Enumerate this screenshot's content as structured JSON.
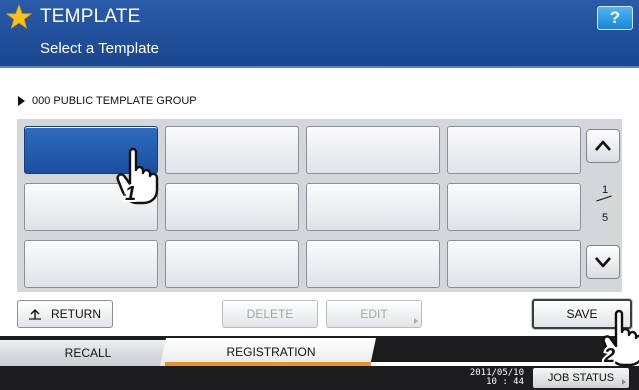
{
  "header": {
    "title": "TEMPLATE",
    "subtitle": "Select a Template",
    "help_label": "?"
  },
  "group": {
    "label": "000 PUBLIC TEMPLATE GROUP"
  },
  "grid": {
    "rows": 3,
    "columns": 4,
    "selected_index": 0
  },
  "pagination": {
    "current": "1",
    "total": "5"
  },
  "buttons": {
    "return_label": "RETURN",
    "delete_label": "DELETE",
    "edit_label": "EDIT",
    "save_label": "SAVE"
  },
  "tabs": [
    {
      "label": "RECALL",
      "active": false
    },
    {
      "label": "REGISTRATION",
      "active": true
    }
  ],
  "footer": {
    "date": "2011/05/10",
    "time": "10 : 44",
    "job_status_label": "JOB STATUS"
  },
  "callouts": [
    "1",
    "2"
  ],
  "icons": {
    "title_icon": "star-icon",
    "return_icon": "return-arrow-icon",
    "page_up_icon": "chevron-up-icon",
    "page_down_icon": "chevron-down-icon",
    "pointer_icon": "pointing-hand-icon"
  },
  "colors": {
    "header": "#1b4690",
    "selected_cell": "#1a4f9e",
    "tab_accent": "#e69324",
    "help_button": "#1a86d9"
  }
}
